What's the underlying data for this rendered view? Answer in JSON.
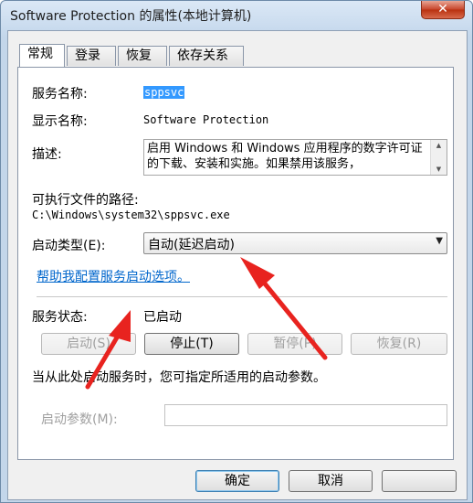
{
  "window": {
    "title": "Software Protection 的属性(本地计算机)",
    "close_glyph": "✕"
  },
  "tabs": [
    {
      "label": "常规"
    },
    {
      "label": "登录"
    },
    {
      "label": "恢复"
    },
    {
      "label": "依存关系"
    }
  ],
  "general": {
    "service_name_label": "服务名称:",
    "service_name_value": "sppsvc",
    "display_name_label": "显示名称:",
    "display_name_value": "Software Protection",
    "description_label": "描述:",
    "description_value": "启用 Windows 和 Windows 应用程序的数字许可证的下载、安装和实施。如果禁用该服务，",
    "path_label": "可执行文件的路径:",
    "path_value": "C:\\Windows\\system32\\sppsvc.exe",
    "startup_type_label": "启动类型(E):",
    "startup_type_value": "自动(延迟启动)",
    "help_link": "帮助我配置服务启动选项。",
    "status_label": "服务状态:",
    "status_value": "已启动",
    "buttons": {
      "start": "启动(S)",
      "stop": "停止(T)",
      "pause": "暂停(P)",
      "resume": "恢复(R)"
    },
    "hint": "当从此处启动服务时，您可指定所适用的启动参数。",
    "start_params_label": "启动参数(M):",
    "start_params_value": ""
  },
  "footer": {
    "ok": "确定",
    "cancel": "取消",
    "watermark": ""
  },
  "colors": {
    "annotation_arrow": "#e8231f",
    "link": "#0066cc",
    "selection": "#3399ff"
  }
}
